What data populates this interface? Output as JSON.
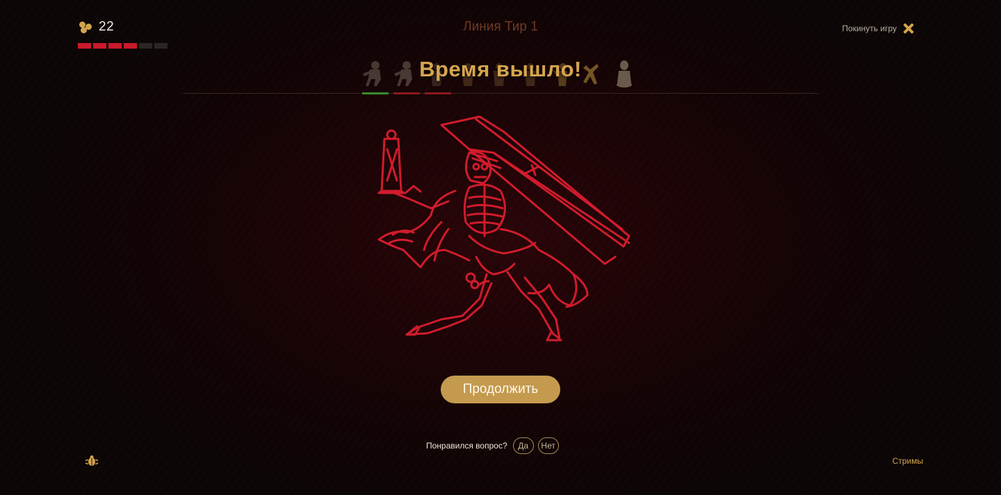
{
  "header": {
    "score": "22",
    "lives_total": 6,
    "lives_remaining": 4,
    "level_title": "Линия Тир 1",
    "leave_label": "Покинуть игру"
  },
  "round": {
    "title": "Время вышло!",
    "hero_count": 9,
    "answered_statuses": [
      "correct",
      "wrong",
      "wrong"
    ]
  },
  "actions": {
    "continue_label": "Продолжить"
  },
  "feedback": {
    "question": "Понравился вопрос?",
    "yes_label": "Да",
    "no_label": "Нет"
  },
  "footer": {
    "streams_label": "Стримы"
  },
  "colors": {
    "accent_gold": "#d6a54e",
    "life_red": "#c81a2a",
    "correct_green": "#3a8a2a",
    "wrong_red": "#8a1a1a"
  }
}
